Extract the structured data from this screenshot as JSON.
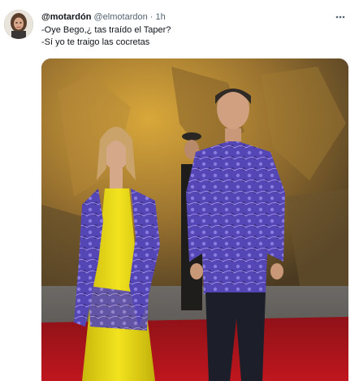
{
  "tweet": {
    "display_name": "@motardón",
    "handle": "@elmotardon",
    "separator": "·",
    "time": "1h",
    "lines": [
      "-Oye Bego,¿ tas traído el Taper?",
      "-Sí yo te traigo las cocretas"
    ],
    "more_icon": "more-horizontal-dots",
    "avatar": "avatar-photo",
    "media": "photo-couple-red-carpet"
  },
  "colors": {
    "text_primary": "#0f1419",
    "text_secondary": "#536471",
    "dress_yellow": "#e6d617",
    "shirt_purple": "#5a4bc0",
    "carpet_red": "#b3151c"
  }
}
